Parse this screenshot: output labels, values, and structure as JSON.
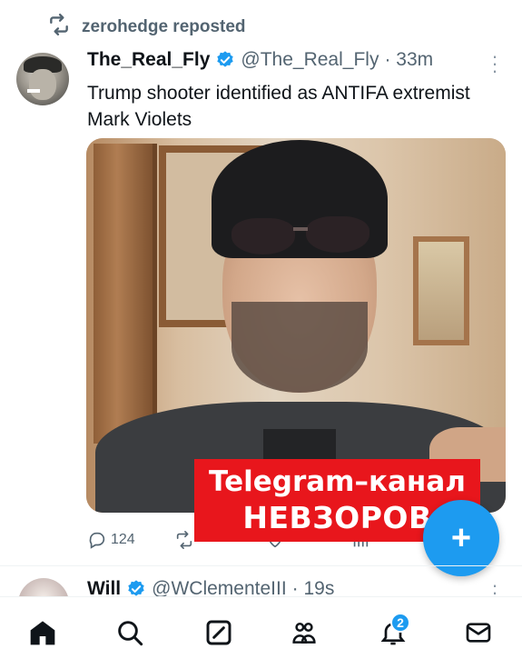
{
  "repost": {
    "label": "zerohedge reposted",
    "icon": "repost-icon"
  },
  "tweet": {
    "display_name": "The_Real_Fly",
    "handle": "@The_Real_Fly",
    "time": "· 33m",
    "text": "Trump shooter identified as ANTIFA extremist Mark Violets",
    "actions": {
      "replies": "124",
      "reposts": "",
      "likes": "",
      "views": ""
    }
  },
  "watermark": {
    "line1": "Telegram–канал",
    "line2": "НЕВЗОРОВ"
  },
  "fab": {
    "label": "+"
  },
  "next_tweet": {
    "display_name": "Will",
    "handle": "@WClementeIII",
    "time": "· 19s"
  },
  "bottom_nav": {
    "notifications_badge": "2",
    "items": [
      "home-icon",
      "search-icon",
      "grok-icon",
      "communities-icon",
      "notifications-icon",
      "messages-icon"
    ]
  },
  "colors": {
    "accent": "#1d9bf0",
    "muted_text": "#536471",
    "watermark_bg": "#e8161c"
  }
}
